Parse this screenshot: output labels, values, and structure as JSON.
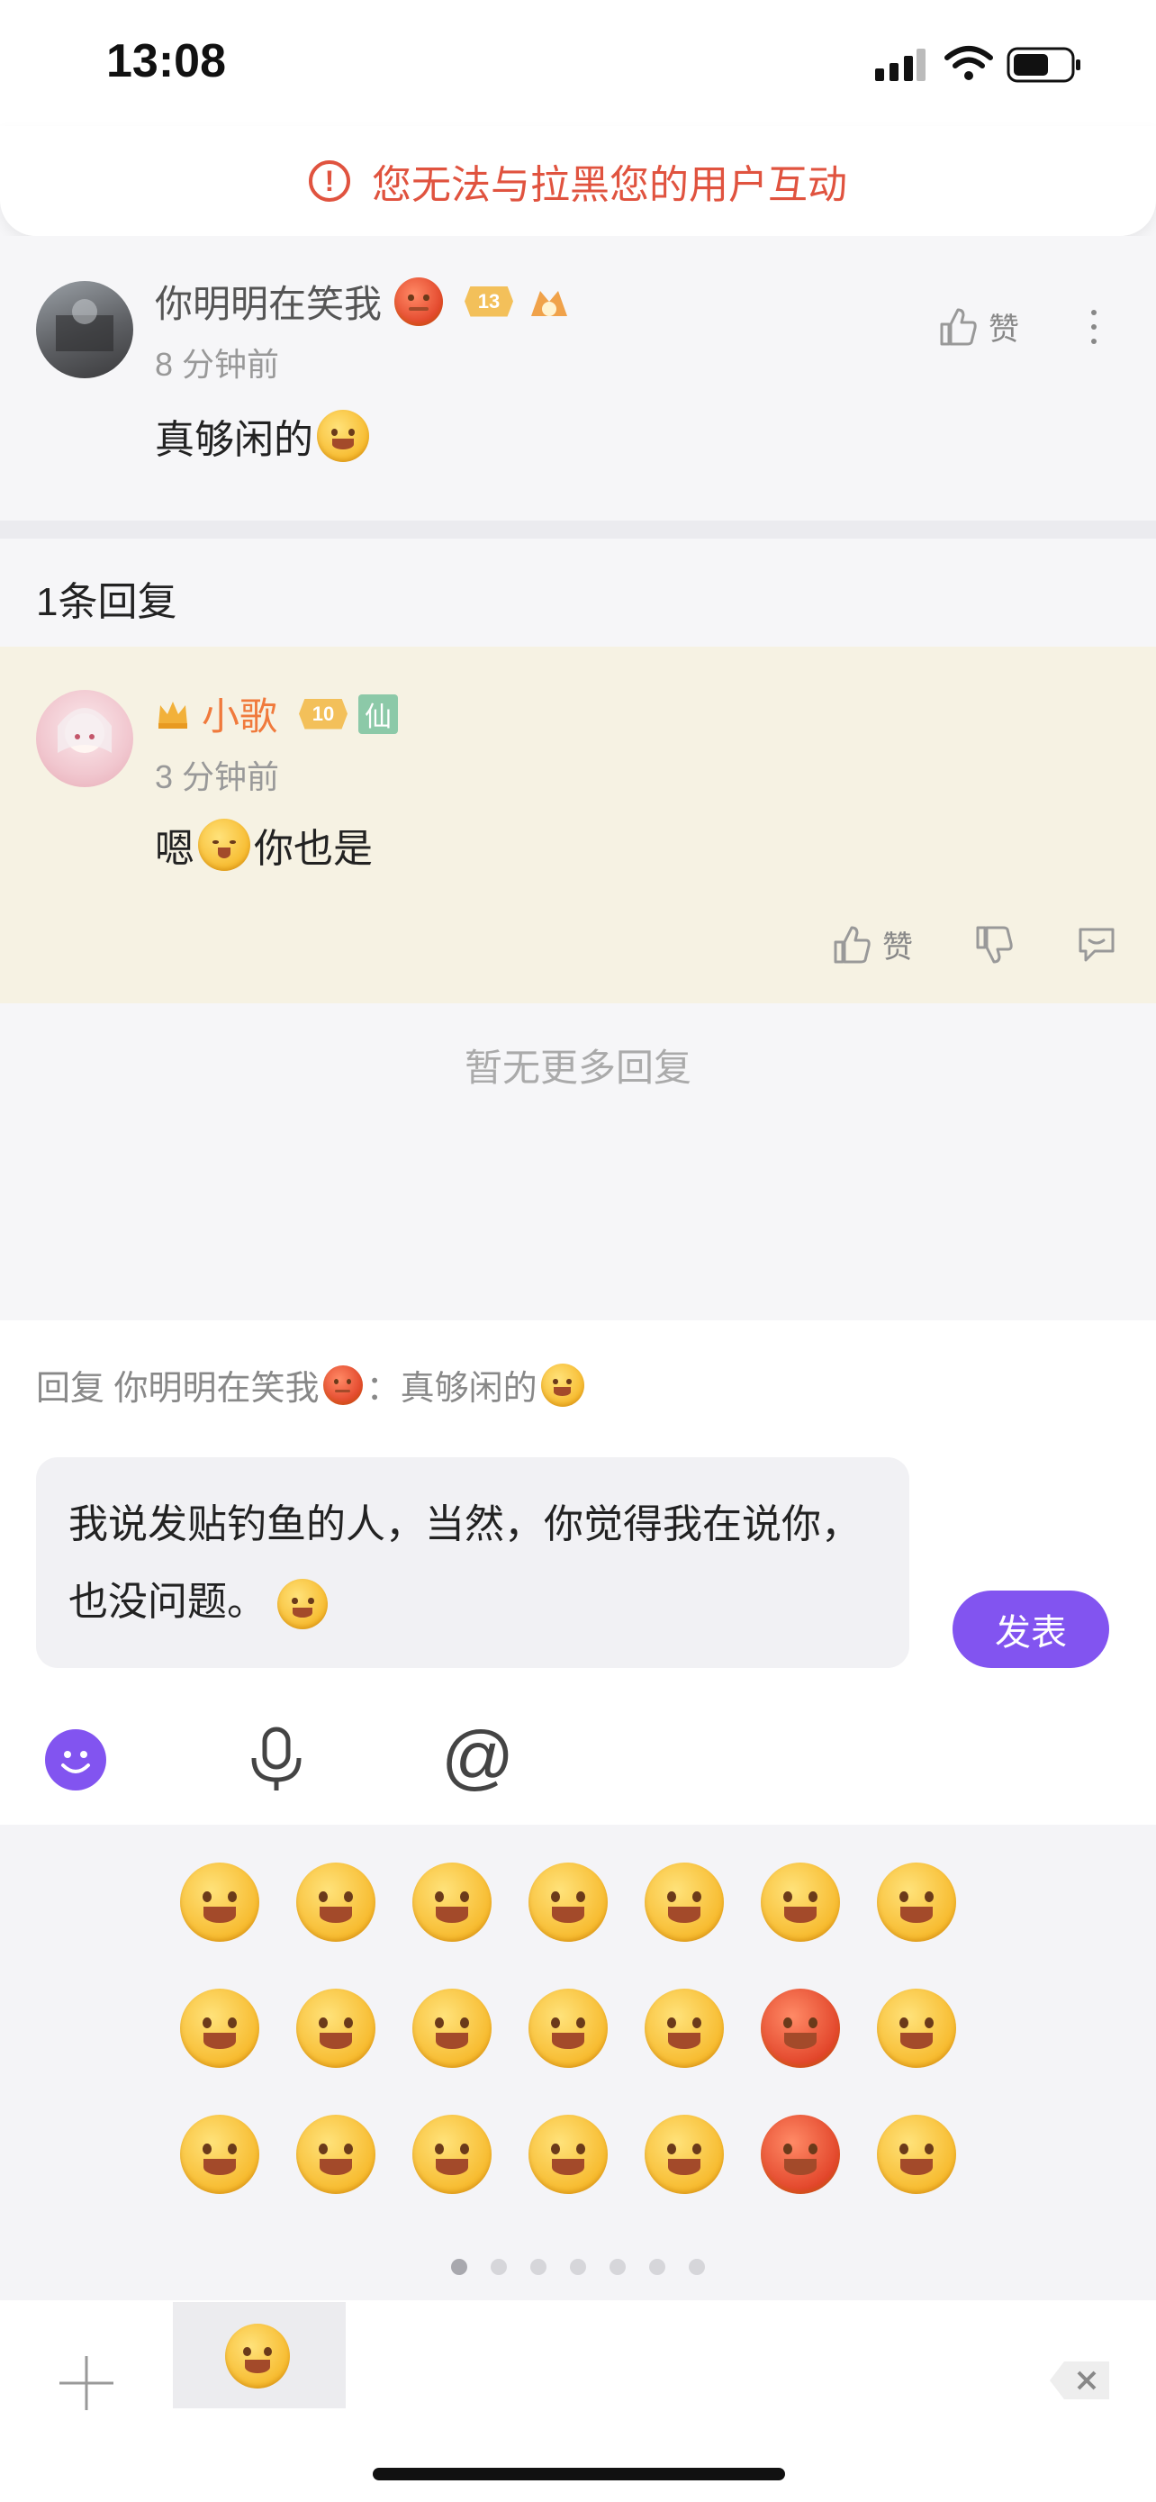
{
  "status_bar": {
    "time": "13:08"
  },
  "banner": {
    "text": "您无法与拉黑您的用户互动"
  },
  "main_comment": {
    "username": "你明明在笑我",
    "level": "13",
    "time": "8 分钟前",
    "text": "真够闲的",
    "like_label": "赞"
  },
  "replies": {
    "count_label": "1条回复",
    "items": [
      {
        "username": "小歌",
        "level": "10",
        "badge": "仙",
        "time": "3 分钟前",
        "text_before": "嗯",
        "text_after": "你也是",
        "like_label": "赞"
      }
    ],
    "no_more": "暂无更多回复"
  },
  "composer": {
    "reply_to_prefix": "回复 你明明在笑我",
    "reply_to_suffix": "：真够闲的",
    "input_text": "我说发贴钓鱼的人，当然，你觉得我在说你，也没问题。",
    "send_label": "发表"
  },
  "colors": {
    "accent": "#8254f0",
    "warning": "#e0533f",
    "reply_bg": "#f6f2e3"
  },
  "emoji_panel": {
    "page_count": 7,
    "active_page": 0,
    "emoji_count": 21
  }
}
